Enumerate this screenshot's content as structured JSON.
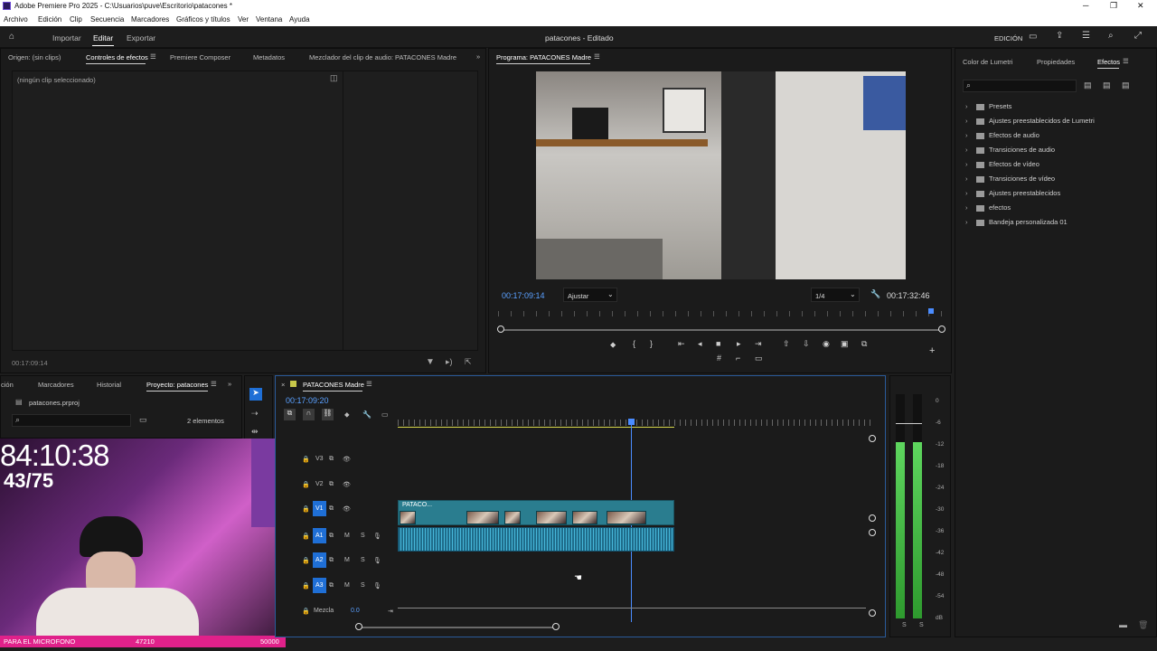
{
  "window": {
    "title": "Adobe Premiere Pro 2025 - C:\\Usuarios\\puve\\Escritorio\\patacones *",
    "minimize": "─",
    "maximize": "❐",
    "close": "✕"
  },
  "menu": [
    "Archivo",
    "Edición",
    "Clip",
    "Secuencia",
    "Marcadores",
    "Gráficos y títulos",
    "Ver",
    "Ventana",
    "Ayuda"
  ],
  "topnav": {
    "tabs": [
      "Importar",
      "Editar",
      "Exportar"
    ],
    "active": "Editar",
    "project_title": "patacones - Editado",
    "workspace": "EDICIÓN"
  },
  "source_panel": {
    "tabs": [
      "Origen: (sin clips)",
      "Controles de efectos",
      "Premiere Composer",
      "Metadatos",
      "Mezclador del clip de audio: PATACONES Madre"
    ],
    "active": "Controles de efectos",
    "no_clip": "(ningún clip seleccionado)",
    "timecode": "00:17:09:14"
  },
  "program": {
    "tab": "Programa: PATACONES Madre",
    "timecode_left": "00:17:09:14",
    "fit": "Ajustar",
    "resolution": "1/4",
    "timecode_right": "00:17:32:46"
  },
  "effects_panel": {
    "tabs": [
      "Color de Lumetri",
      "Propiedades",
      "Efectos"
    ],
    "active": "Efectos",
    "folders": [
      "Presets",
      "Ajustes preestablecidos de Lumetri",
      "Efectos de audio",
      "Transiciones de audio",
      "Efectos de vídeo",
      "Transiciones de vídeo",
      "Ajustes preestablecidos",
      "efectos",
      "Bandeja personalizada 01"
    ]
  },
  "project_panel": {
    "tabs": [
      "ción",
      "Marcadores",
      "Historial",
      "Proyecto: patacones"
    ],
    "active": "Proyecto: patacones",
    "file": "patacones.prproj",
    "count": "2 elementos"
  },
  "timeline": {
    "tab": "PATACONES Madre",
    "timecode": "00:17:09:20",
    "video_tracks": [
      "V3",
      "V2",
      "V1"
    ],
    "audio_tracks": [
      "A1",
      "A2",
      "A3"
    ],
    "mix_label": "Mezcla",
    "mix_value": "0.0",
    "clip_name": "PATACO..."
  },
  "meter": {
    "scale": [
      "0",
      "-6",
      "-12",
      "-18",
      "-24",
      "-30",
      "-36",
      "-42",
      "-48",
      "-54",
      "dB"
    ],
    "solo": [
      "S",
      "S"
    ]
  },
  "overlay": {
    "timer": "84:10:38",
    "counter": "43/75",
    "banner_text": "PARA EL MICROFONO",
    "banner_value": "47210",
    "banner_goal": "50000"
  }
}
